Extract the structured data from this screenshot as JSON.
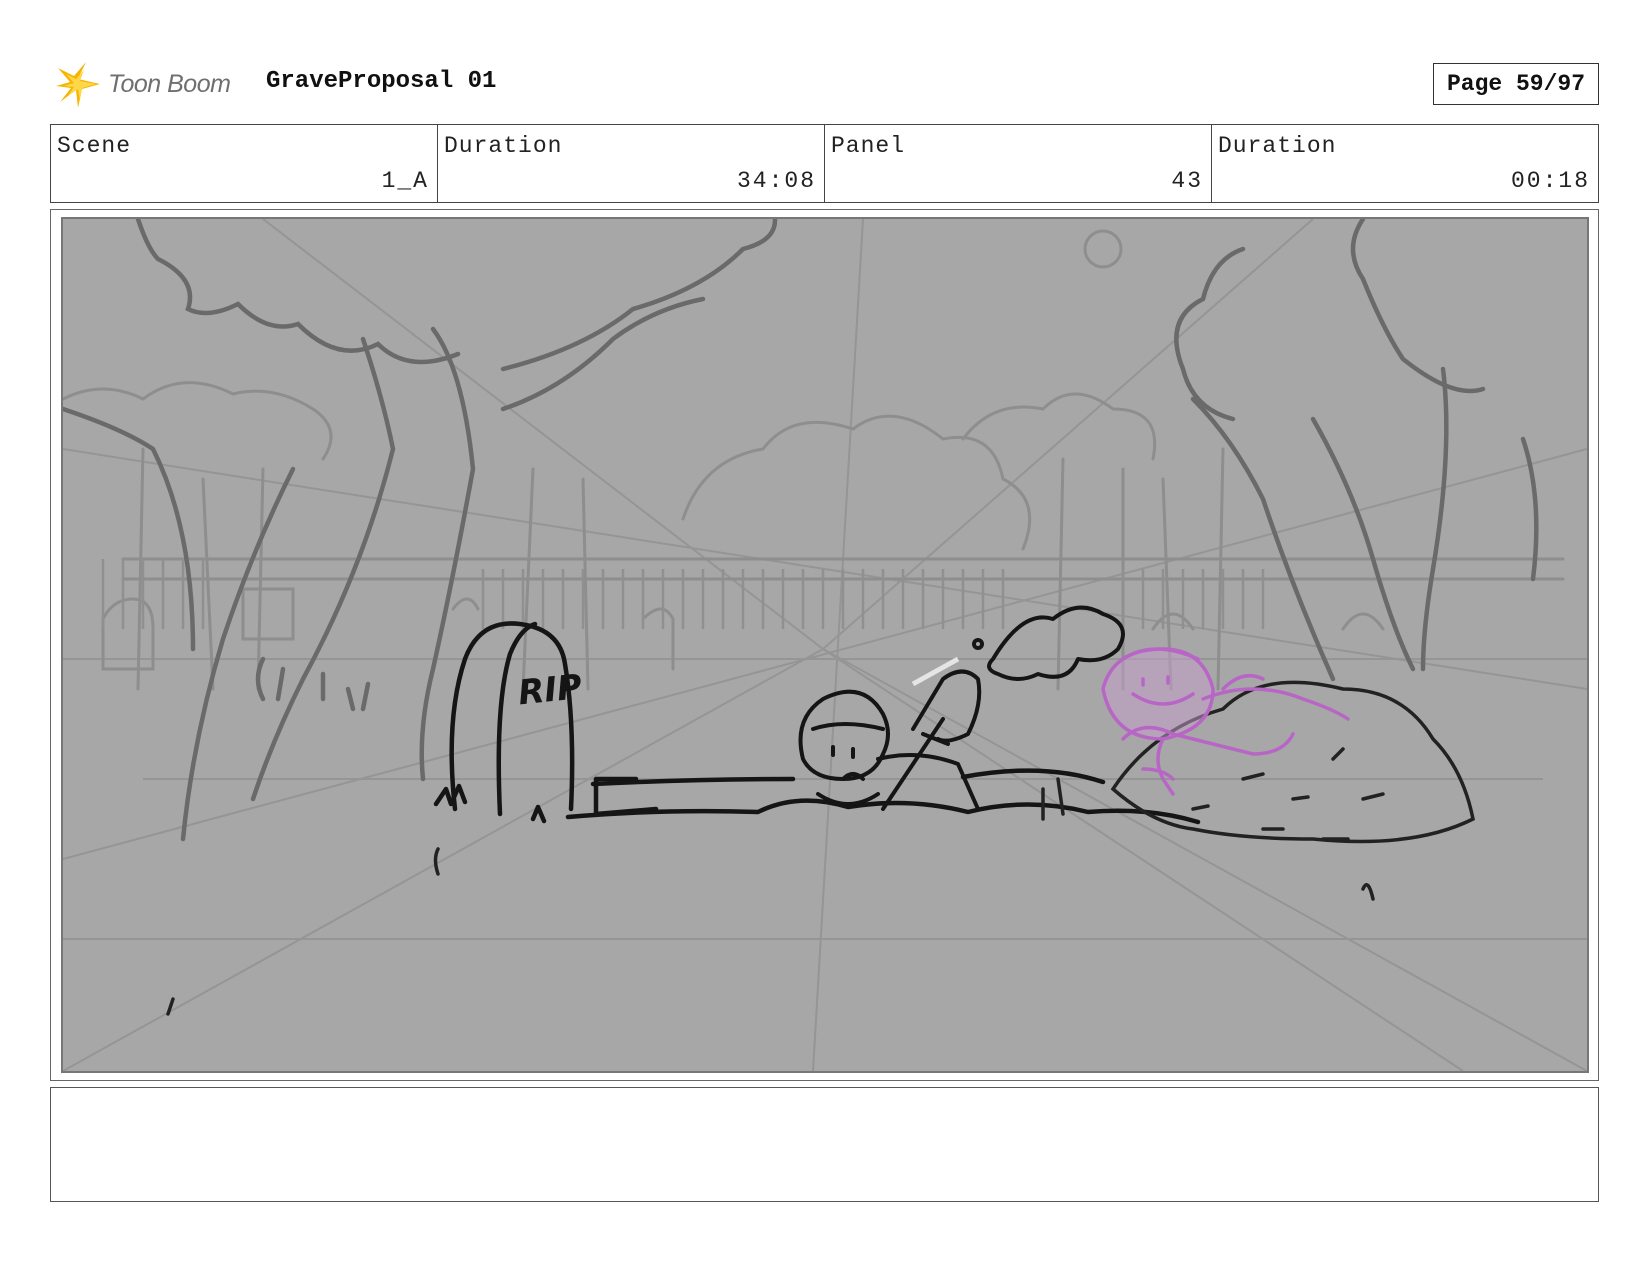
{
  "header": {
    "logo_text": "Toon Boom",
    "project_title": "GraveProposal 01",
    "page_label": "Page 59/97"
  },
  "info": [
    {
      "label": "Scene",
      "value": "1_A"
    },
    {
      "label": "Duration",
      "value": "34:08"
    },
    {
      "label": "Panel",
      "value": "43"
    },
    {
      "label": "Duration",
      "value": "00:18"
    }
  ],
  "panel": {
    "tombstone_text": "RIP"
  },
  "notes": {
    "text": ""
  },
  "colors": {
    "sketch_background": "#a7a7a7",
    "ghost_character": "#c47ad0",
    "logo_star": "#f7b500"
  }
}
